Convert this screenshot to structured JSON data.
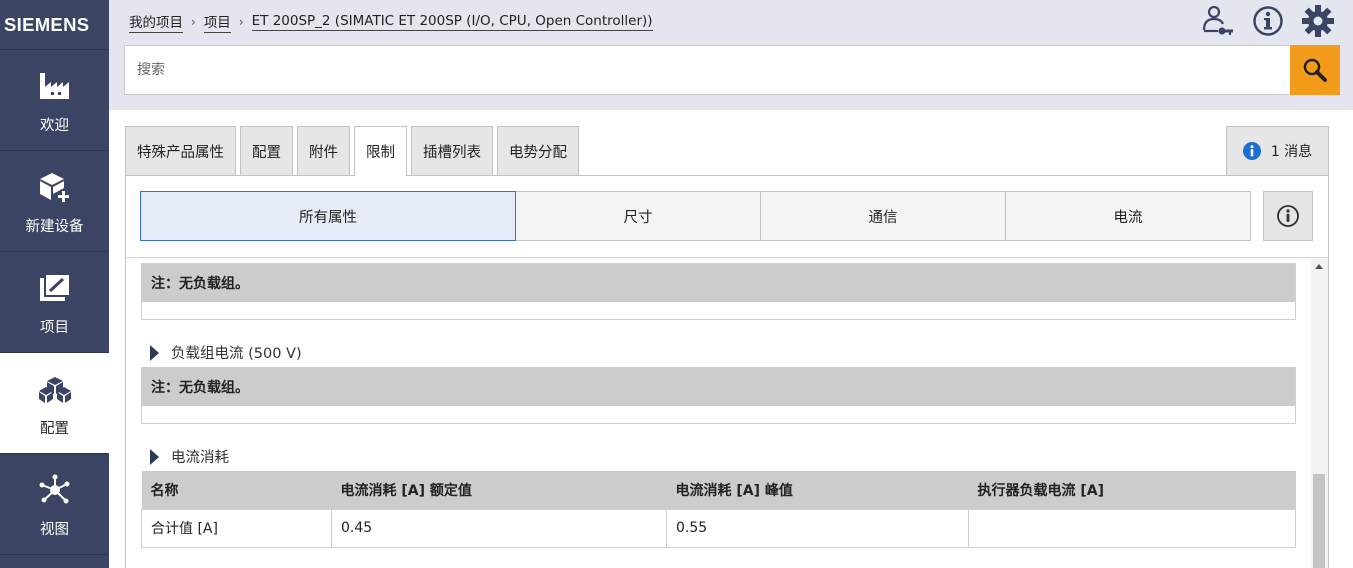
{
  "brand": "SIEMENS",
  "sidebar": {
    "items": [
      {
        "label": "欢迎",
        "icon": "factory-icon"
      },
      {
        "label": "新建设备",
        "icon": "new-device-icon"
      },
      {
        "label": "项目",
        "icon": "project-icon"
      },
      {
        "label": "配置",
        "icon": "configuration-icon"
      },
      {
        "label": "视图",
        "icon": "network-view-icon"
      }
    ],
    "active": "配置"
  },
  "breadcrumb": [
    "我的项目",
    "项目",
    "ET 200SP_2 (SIMATIC ET 200SP (I/O, CPU, Open Controller))"
  ],
  "search": {
    "placeholder": "搜索"
  },
  "tabs": [
    "特殊产品属性",
    "配置",
    "附件",
    "限制",
    "插槽列表",
    "电势分配"
  ],
  "active_tab": "限制",
  "messages": {
    "count_label": "1 消息"
  },
  "filters": [
    "所有属性",
    "尺寸",
    "通信",
    "电流"
  ],
  "active_filter": "所有属性",
  "content": {
    "note1": "注：无负载组。",
    "section2_title": "负载组电流 (500 V)",
    "note2": "注：无负载组。",
    "section3_title": "电流消耗",
    "table": {
      "headers": [
        "名称",
        "电流消耗 [A] 额定值",
        "电流消耗 [A] 峰值",
        "执行器负载电流 [A]"
      ],
      "rows": [
        [
          "合计值 [A]",
          "0.45",
          "0.55",
          ""
        ]
      ]
    }
  },
  "colors": {
    "sidebar": "#3b4563",
    "header": "#e3e6ef",
    "search_button": "#f39c1c",
    "active_filter_border": "#3b6cc6"
  }
}
